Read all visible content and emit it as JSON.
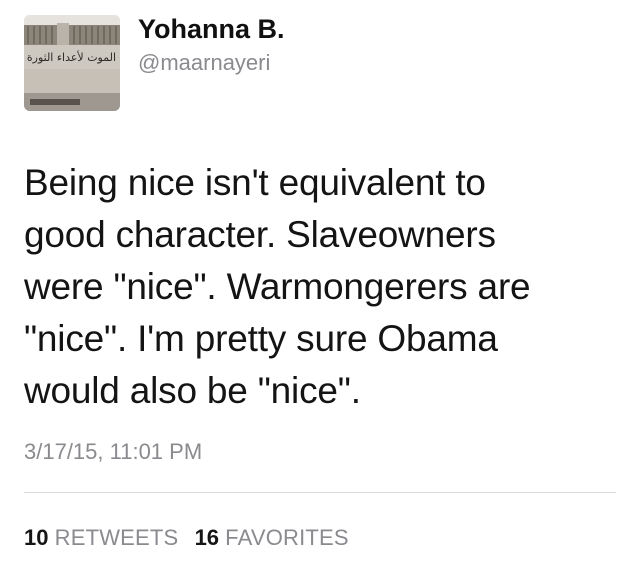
{
  "user": {
    "display_name": "Yohanna B.",
    "handle": "@maarnayeri",
    "avatar_text": "الموت لأعداء الثورة"
  },
  "tweet": {
    "lines": [
      "Being nice isn't equivalent to",
      "good character. Slaveowners",
      "were \"nice\". Warmongerers are",
      "\"nice\". I'm pretty sure Obama",
      "would also be \"nice\"."
    ],
    "timestamp": "3/17/15, 11:01 PM"
  },
  "stats": {
    "retweets_count": "10",
    "retweets_label": "RETWEETS",
    "favorites_count": "16",
    "favorites_label": "FAVORITES"
  },
  "colors": {
    "text": "#141414",
    "muted": "#8a8a8f",
    "divider": "#d9d9de"
  }
}
